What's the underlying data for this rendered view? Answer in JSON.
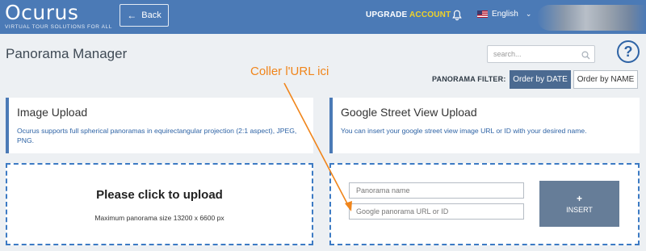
{
  "header": {
    "logo_text": "Ocurus",
    "logo_tagline": "VIRTUAL TOUR SOLUTIONS FOR ALL",
    "back_label": "Back",
    "upgrade_label": "UPGRADE",
    "account_label": "ACCOUNT",
    "language": "English"
  },
  "page": {
    "title": "Panorama Manager",
    "search_placeholder": "search...",
    "help_label": "?",
    "filter_label": "PANORAMA FILTER:",
    "order_date_label": "Order by DATE",
    "order_name_label": "Order by NAME"
  },
  "image_upload": {
    "title": "Image Upload",
    "description": "Ocurus supports full spherical panoramas in equirectangular projection (2:1 aspect), JPEG, PNG.",
    "dropzone_title": "Please click to upload",
    "dropzone_subtitle": "Maximum panorama size 13200 x 6600 px"
  },
  "street_view": {
    "title": "Google Street View Upload",
    "description": "You can insert your google street view image URL or ID with your desired name.",
    "name_placeholder": "Panorama name",
    "url_placeholder": "Google panorama URL or ID",
    "insert_label": "INSERT",
    "insert_symbol": "+"
  },
  "annotation": {
    "text": "Coller l'URL ici"
  },
  "colors": {
    "topbar": "#4b7ab6",
    "accent_yellow": "#f0d328",
    "annotation_orange": "#f0851b",
    "dashed_border": "#3d7bc4",
    "insert_button": "#667d98"
  },
  "icons": {
    "back": "arrow-left-icon",
    "notifications": "bell-icon",
    "flag": "us-flag-icon",
    "dropdown": "chevron-down-icon",
    "search": "search-icon",
    "help": "help-circle-icon"
  }
}
